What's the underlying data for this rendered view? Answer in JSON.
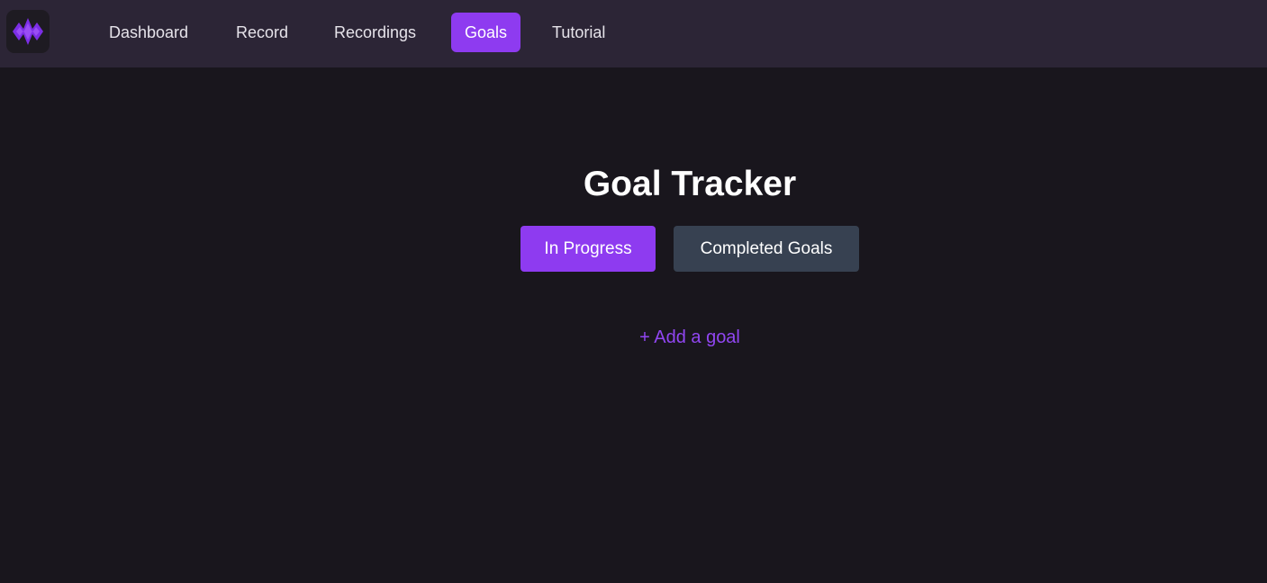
{
  "nav": {
    "logo_icon": "waveform-logo-icon",
    "items": [
      {
        "label": "Dashboard",
        "active": false
      },
      {
        "label": "Record",
        "active": false
      },
      {
        "label": "Recordings",
        "active": false
      },
      {
        "label": "Goals",
        "active": true
      },
      {
        "label": "Tutorial",
        "active": false
      }
    ]
  },
  "main": {
    "title": "Goal Tracker",
    "tabs": {
      "in_progress": "In Progress",
      "completed": "Completed Goals"
    },
    "add_goal_label": "+ Add a goal"
  },
  "colors": {
    "accent": "#8e3bf0",
    "background": "#19161d",
    "topbar": "#2c2536",
    "secondary_button": "#374151"
  }
}
